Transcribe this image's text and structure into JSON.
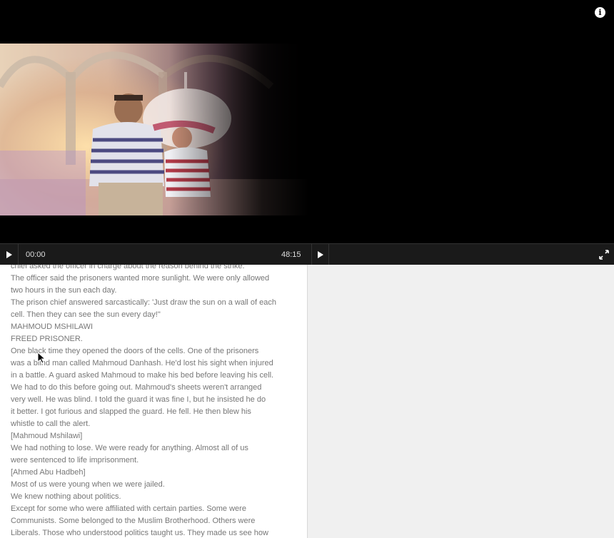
{
  "player": {
    "current_time": "00:00",
    "duration": "48:15"
  },
  "icons": {
    "info": "info-icon",
    "play": "play-icon",
    "fullscreen": "fullscreen-icon"
  },
  "transcript": {
    "lines": [
      "chief asked the officer in charge about the reason behind the strike.",
      " The officer said the prisoners wanted more sunlight.  We were only allowed",
      "two hours in the sun each day.",
      " The prison chief answered sarcastically: 'Just draw the sun on a wall of each",
      "cell.  Then they can see the sun every day!\"",
      " MAHMOUD MSHILAWI",
      " FREED PRISONER.",
      " One black time they opened the doors of the cells.  One of the prisoners",
      "was a blind man called Mahmoud Danhash.  He'd lost his sight when injured",
      "in a battle.  A guard asked Mahmoud to make his bed before leaving his cell.",
      "We had to do this before going out.  Mahmoud's sheets weren't arranged",
      "very well.  He was blind.  I told the guard it was fine I, but he insisted he do",
      "it better.  I got furious and slapped the guard.  He fell.  He then blew his",
      "whistle to call the alert.",
      " [Mahmoud Mshilawi]",
      " We had nothing to lose.  We were ready  for anything.  Almost all of us",
      "were sentenced to life imprisonment.",
      " [Ahmed Abu Hadbeh]",
      " Most of us were young when we were jailed.",
      " We knew nothing about politics.",
      " Except for some who were affiliated with certain parties.  Some were",
      "Communists.  Some belonged to the Muslim Brotherhood.  Others were",
      "Liberals.  Those who understood politics taught us.  They made us see how"
    ]
  }
}
